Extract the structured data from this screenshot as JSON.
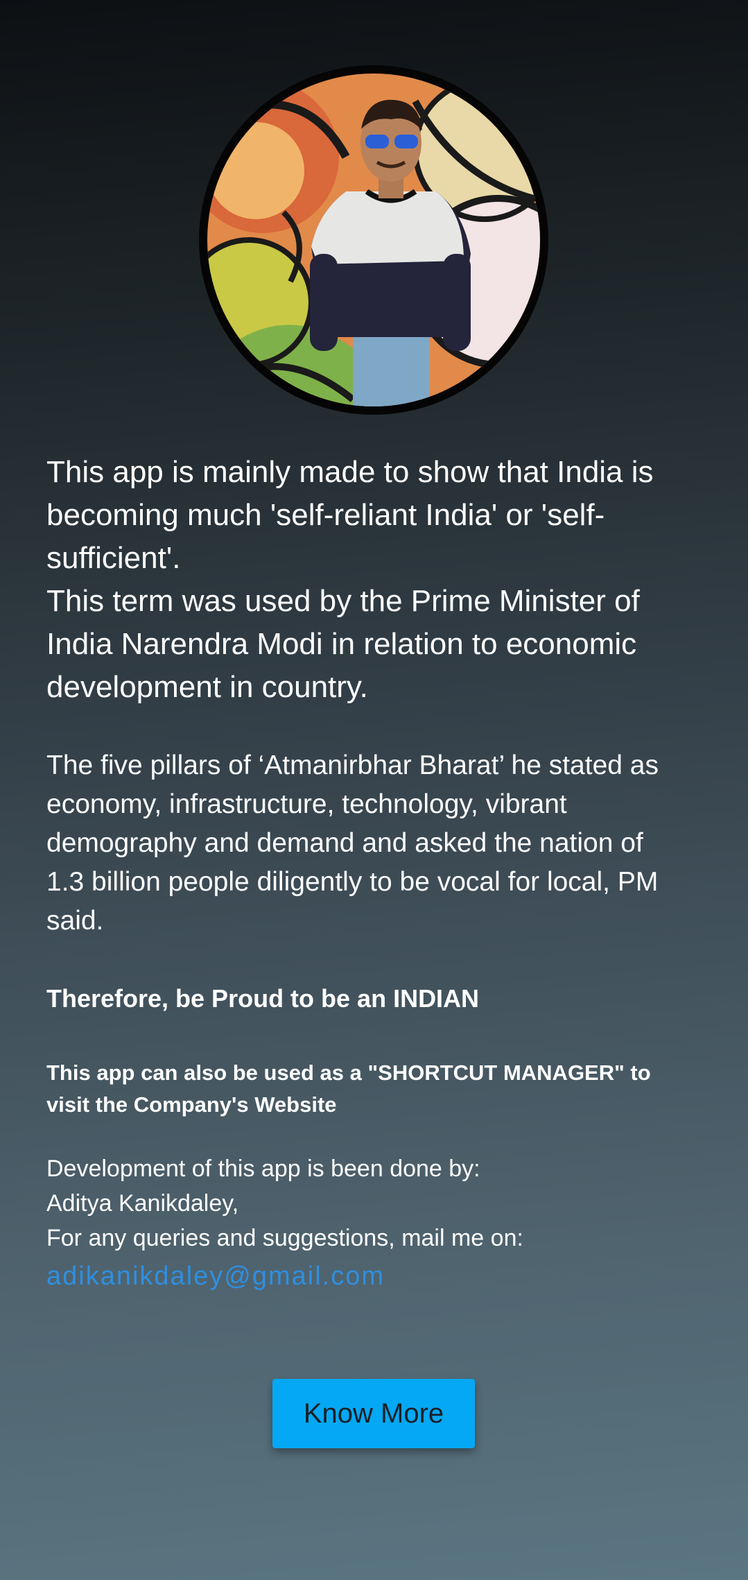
{
  "profile": {
    "avatar_alt": "developer photo"
  },
  "about": {
    "intro_lines": [
      "This app is mainly made to show that India is",
      "becoming much 'self-reliant India' or 'self-",
      "sufficient'.",
      "This term was used by the Prime Minister of",
      "India Narendra Modi in relation to economic",
      "development in country."
    ],
    "pillars_lines": [
      "The five pillars of ‘Atmanirbhar Bharat’ he stated as",
      "economy, infrastructure, technology, vibrant",
      "demography and demand and asked the nation of",
      "1.3 billion people diligently to be vocal for local, PM",
      "said."
    ],
    "proud": "Therefore, be Proud to be an INDIAN",
    "shortcut_lines": [
      "This app can also be used as a \"SHORTCUT MANAGER\" to",
      "visit the Company's Website"
    ]
  },
  "developer": {
    "line1": "Development of this app is been done by:",
    "line2": "Aditya Kanikdaley,",
    "line3": "For any queries and suggestions, mail me on:",
    "email": "adikanikdaley@gmail.com"
  },
  "actions": {
    "know_more_label": "Know More"
  },
  "colors": {
    "accent_button": "#05a8f4",
    "link": "#2f8fe0"
  }
}
